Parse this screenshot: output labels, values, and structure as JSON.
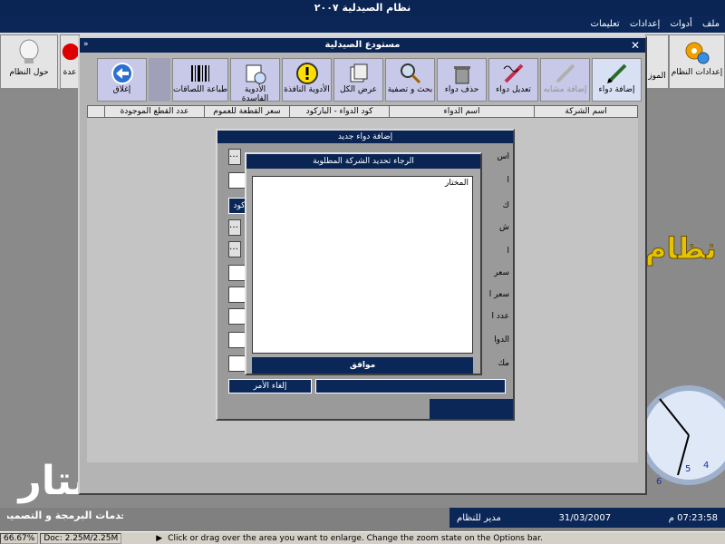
{
  "app": {
    "title": "نظام الصيدلية ٢٠٠٧"
  },
  "menu": [
    "ملف",
    "أدوات",
    "إعدادات",
    "تعليمات"
  ],
  "desktop": {
    "btn_settings": "إعدادات النظام",
    "btn_about": "حول النظام",
    "btn_partial_left": "عدة",
    "btn_partial_right": "الموز",
    "brand": "نظام"
  },
  "inventory": {
    "title": "مستودع الصيدلية",
    "toolbar": {
      "add": "إضافة دواء",
      "add_similar": "إضافة مشابه",
      "edit": "تعديل دواء",
      "delete": "حذف دواء",
      "search": "بحث و تصفية",
      "show_all": "عرض الكل",
      "expired": "الأدوية النافذة",
      "damaged": "الأدوية الفاسدة",
      "print_labels": "طباعة اللصاقات",
      "close": "إغلاق"
    },
    "columns": [
      "اسم الشركة",
      "اسم الدواء",
      "كود الدواء - الباركود",
      "سعر القطعة للعموم",
      "عدد القطع الموجودة"
    ]
  },
  "add_dialog": {
    "title": "إضافة دواء جديد",
    "labels": [
      "اس",
      "ا",
      "ك",
      "ش",
      "ا",
      "سعر",
      "سعر ا",
      "عدد ا",
      "الدوا",
      "مك"
    ],
    "barcode_btn": "كود",
    "cancel": "إلغاء الأمر"
  },
  "company_dialog": {
    "title": "الرجاء تحديد الشركة المطلوبة",
    "list_header": "المختار",
    "ok": "موافق"
  },
  "status": {
    "time": "07:23:58 م",
    "date": "31/03/2007",
    "user": "مدير للنظام"
  },
  "logo": {
    "line1": "ستار",
    "line2": "خدمات البرمجة و التصميم"
  },
  "zoombar": {
    "zoom": "66.67%",
    "doc": "Doc: 2.25M/2.25M",
    "hint": "Click or drag over the area you want to enlarge. Change the zoom state on the Options bar."
  }
}
